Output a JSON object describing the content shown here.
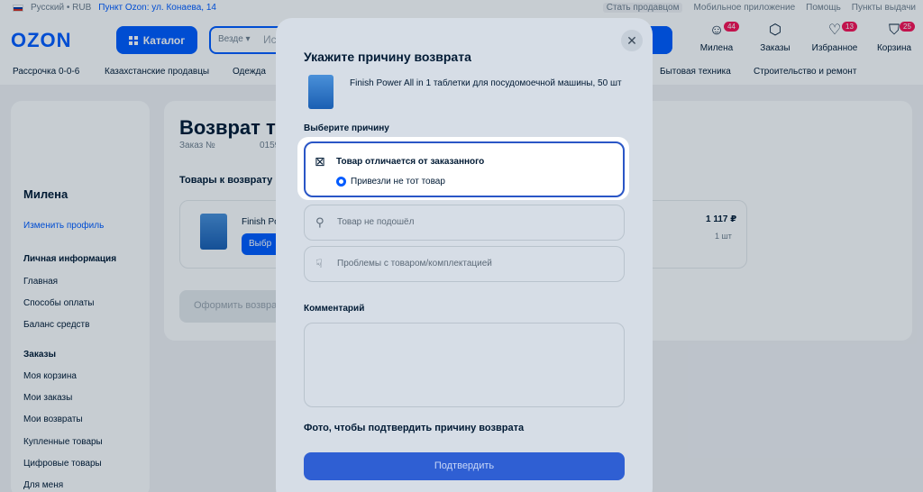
{
  "topbar": {
    "locale": "Русский • RUB",
    "pickup": "Пункт Ozon: ул. Конаева, 14",
    "links": [
      "Стать продавцом",
      "Мобильное приложение",
      "Помощь",
      "Пункты выдачи"
    ]
  },
  "header": {
    "logo": "OZON",
    "catalog": "Каталог",
    "search_scope": "Везде ▾",
    "search_placeholder": "Ис",
    "icons": [
      {
        "label": "Милена",
        "badge": "44"
      },
      {
        "label": "Заказы",
        "badge": ""
      },
      {
        "label": "Избранное",
        "badge": "13"
      },
      {
        "label": "Корзина",
        "badge": "25"
      }
    ]
  },
  "categories": [
    "Рассрочка 0-0-6",
    "Казахстанские продавцы",
    "Одежда",
    "Бытовая техника",
    "Строительство и ремонт"
  ],
  "sidebar": {
    "name": "Милена",
    "edit": "Изменить профиль",
    "personal": "Личная информация",
    "personal_items": [
      "Главная",
      "Способы оплаты",
      "Баланс средств"
    ],
    "orders": "Заказы",
    "order_items": [
      "Моя корзина",
      "Мои заказы",
      "Мои возвраты",
      "Купленные товары",
      "Цифровые товары",
      "Для меня"
    ]
  },
  "main": {
    "title": "Возврат т",
    "order_label": "Заказ №",
    "order_num": "0159",
    "goods_title": "Товары к возврату",
    "goods_name": "Finish Po",
    "goods_btn": "Выбр",
    "price": "1 117 ₽",
    "qty": "1 шт",
    "submit": "Оформить возврат"
  },
  "modal": {
    "title": "Укажите причину возврата",
    "product": "Finish Power All in 1 таблетки для посудомоечной машины, 50 шт",
    "choose": "Выберите причину",
    "selected_reason": "Товар отличается от заказанного",
    "selected_sub": "Привезли не тот товар",
    "reasons": [
      "Товар не подошёл",
      "Проблемы с товаром/комплектацией"
    ],
    "comment": "Комментарий",
    "photo": "Фото, чтобы подтвердить причину возврата",
    "confirm": "Подтвердить"
  }
}
